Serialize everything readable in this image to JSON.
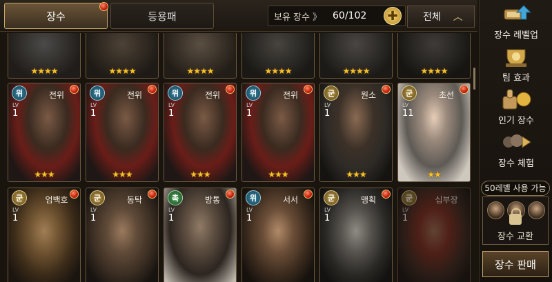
{
  "tabs": {
    "heroes": "장수",
    "equipment": "등용패"
  },
  "owned": {
    "label": "보유 장수",
    "arrow": "》",
    "count": "60/102"
  },
  "filter": {
    "label": "전체",
    "caret": "︿"
  },
  "level_prefix": "LV",
  "top_row_stars": [
    "★★★★",
    "★★★★",
    "★★★★",
    "★★★★",
    "★★★★",
    "★★★★"
  ],
  "cards_row2": [
    {
      "faction": "위",
      "name": "전위",
      "level": "1",
      "stars": "★★★"
    },
    {
      "faction": "위",
      "name": "전위",
      "level": "1",
      "stars": "★★★"
    },
    {
      "faction": "위",
      "name": "전위",
      "level": "1",
      "stars": "★★★"
    },
    {
      "faction": "위",
      "name": "전위",
      "level": "1",
      "stars": "★★★"
    },
    {
      "faction": "군",
      "name": "원소",
      "level": "1",
      "stars": "★★★"
    },
    {
      "faction": "군",
      "name": "초선",
      "level": "11",
      "stars": "★★"
    }
  ],
  "cards_row3": [
    {
      "faction": "군",
      "name": "엄백호",
      "level": "1"
    },
    {
      "faction": "군",
      "name": "동탁",
      "level": "1"
    },
    {
      "faction": "촉",
      "name": "방통",
      "level": "1"
    },
    {
      "faction": "위",
      "name": "서서",
      "level": "1"
    },
    {
      "faction": "군",
      "name": "맹획",
      "level": "1"
    },
    {
      "faction": "군",
      "name": "십부장",
      "level": "1"
    }
  ],
  "side": {
    "levelup": "장수 레벨업",
    "team_effect": "팀 효과",
    "popular": "인기 장수",
    "trial": "장수 체험",
    "available": "50레벨 사용 가능",
    "exchange": "장수 교환",
    "sell": "장수 판매"
  }
}
